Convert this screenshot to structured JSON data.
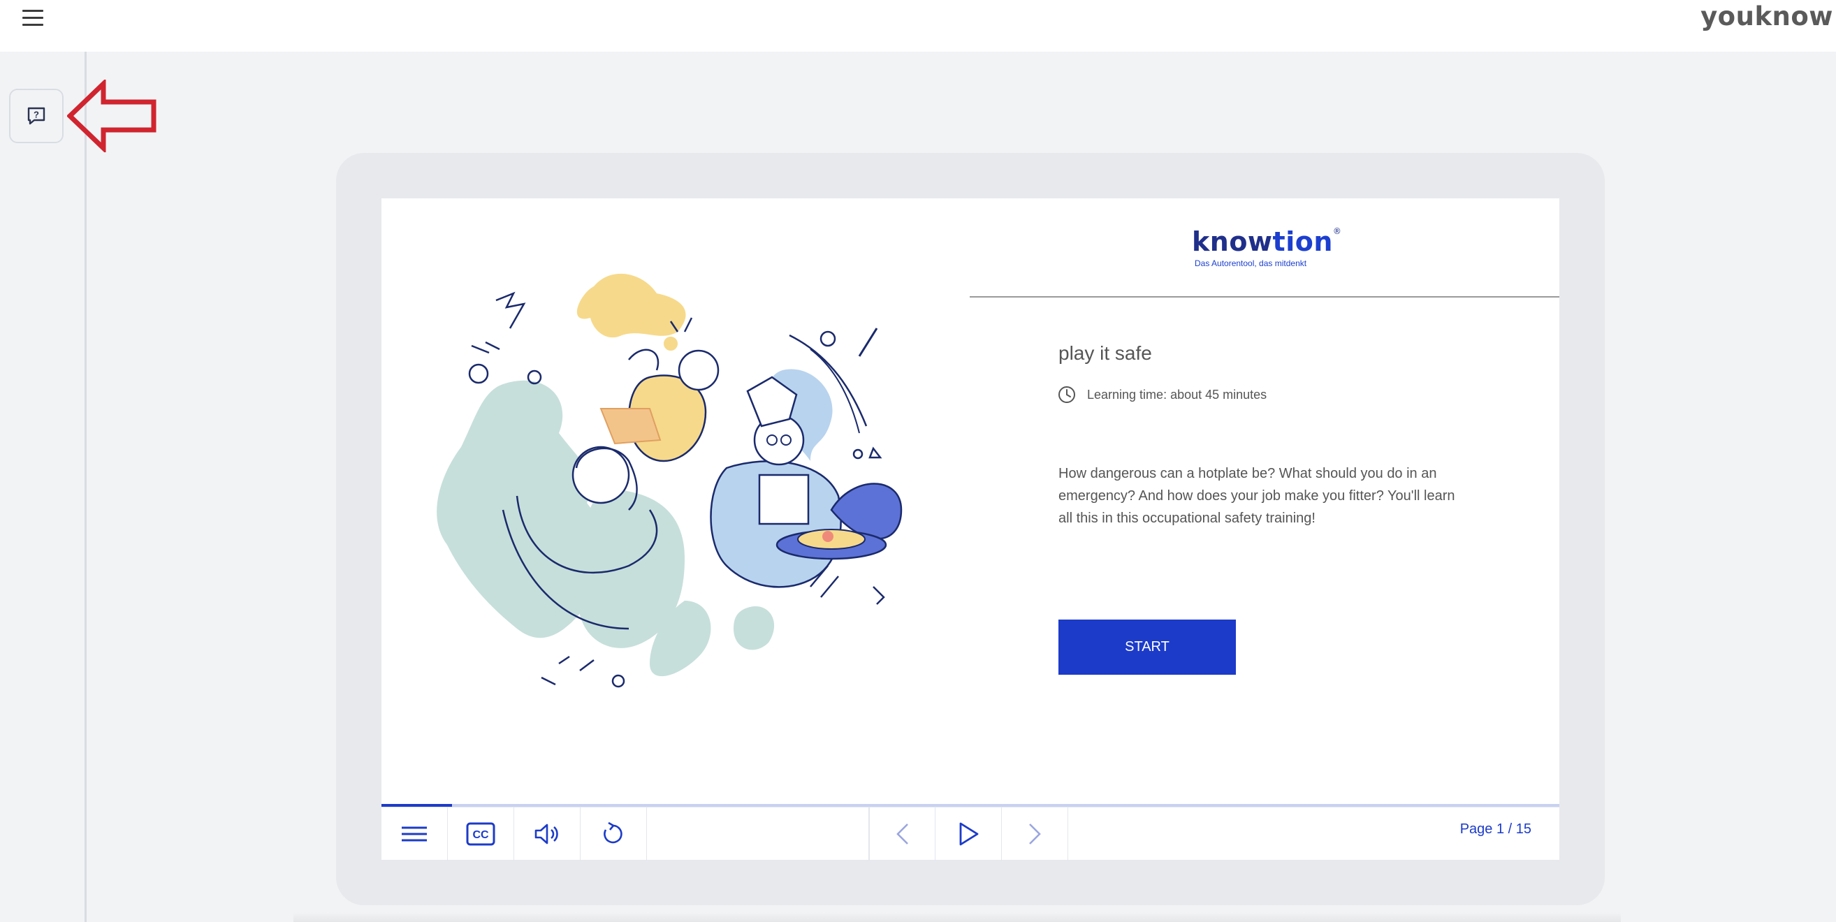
{
  "header": {
    "brand": "youknow",
    "menu_icon": "hamburger-menu-icon"
  },
  "rail": {
    "help_icon": "help-chat-icon"
  },
  "course": {
    "logo_name_part1": "know",
    "logo_name_part2": "tion",
    "logo_registered": "®",
    "logo_tagline": "Das Autorentool, das mitdenkt",
    "title": "play it safe",
    "learning_time": "Learning time: about 45 minutes",
    "description": "How dangerous can a hotplate be? What should you do in an emergency? And how does your job make you fitter? You'll learn all this in this occupational safety training!",
    "start_label": "START"
  },
  "player": {
    "progress": 0.06,
    "page_indicator": "Page 1 / 15",
    "controls": [
      "menu-icon",
      "closed-captions-icon",
      "volume-icon",
      "replay-icon",
      "previous-icon",
      "play-icon",
      "next-icon"
    ],
    "accent_color": "#1c3bc9"
  },
  "colors": {
    "annotation_arrow": "#d0242f",
    "frame_bg": "#e7e9ed"
  }
}
